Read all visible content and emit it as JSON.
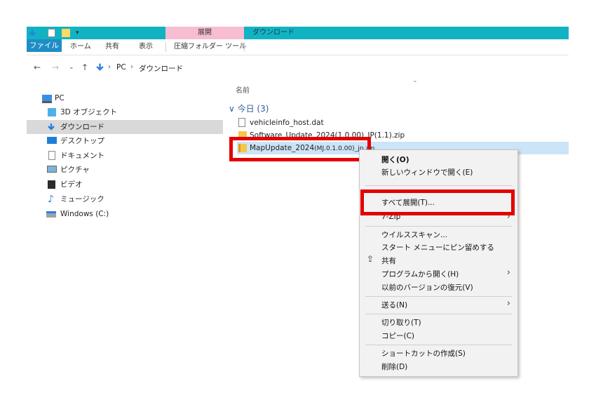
{
  "titlebar": {
    "context_tab": "展開",
    "title": "ダウンロード",
    "accent": "#11b3c3",
    "context_color": "#f7bdd2"
  },
  "ribbon": {
    "tabs": [
      "ファイル",
      "ホーム",
      "共有",
      "表示",
      "圧縮フォルダー ツール"
    ]
  },
  "address": {
    "path": [
      "PC",
      "ダウンロード"
    ]
  },
  "nav_pane": {
    "items": [
      {
        "label": "PC",
        "icon": "pc-icon"
      },
      {
        "label": "3D オブジェクト",
        "icon": "3d-objects-icon"
      },
      {
        "label": "ダウンロード",
        "icon": "download-icon",
        "selected": true
      },
      {
        "label": "デスクトップ",
        "icon": "desktop-icon"
      },
      {
        "label": "ドキュメント",
        "icon": "documents-icon"
      },
      {
        "label": "ピクチャ",
        "icon": "pictures-icon"
      },
      {
        "label": "ビデオ",
        "icon": "video-icon"
      },
      {
        "label": "ミュージック",
        "icon": "music-icon"
      },
      {
        "label": "Windows (C:)",
        "icon": "drive-icon"
      }
    ]
  },
  "file_list": {
    "column_name": "名前",
    "group": "今日 (3)",
    "files": [
      {
        "name": "vehicleinfo_host.dat",
        "icon": "file-icon"
      },
      {
        "name": "Software_Update_2024(1.0.00)_JP(1.1).zip",
        "icon": "zip-folder-icon"
      },
      {
        "name_main": "MapUpdate_2024",
        "name_small": "(MJ.0.1.0.00)_jp.zip",
        "icon": "zip-folder-icon",
        "selected": true
      }
    ]
  },
  "context_menu": {
    "items": [
      {
        "label": "開く(O)",
        "bold": true
      },
      {
        "label": "新しいウィンドウで開く(E)"
      },
      {
        "label": "すべて展開(T)...",
        "highlighted": true
      },
      {
        "label": "7-Zip",
        "submenu": true
      },
      {
        "label": "ウイルススキャン..."
      },
      {
        "label": "スタート メニューにピン留めする"
      },
      {
        "label": "共有",
        "icon": "share-icon"
      },
      {
        "label": "プログラムから開く(H)",
        "submenu": true
      },
      {
        "label": "以前のバージョンの復元(V)"
      },
      {
        "label": "送る(N)",
        "submenu": true
      },
      {
        "label": "切り取り(T)"
      },
      {
        "label": "コピー(C)"
      },
      {
        "label": "ショートカットの作成(S)"
      },
      {
        "label": "削除(D)"
      }
    ]
  },
  "highlight_color": "#e30000"
}
